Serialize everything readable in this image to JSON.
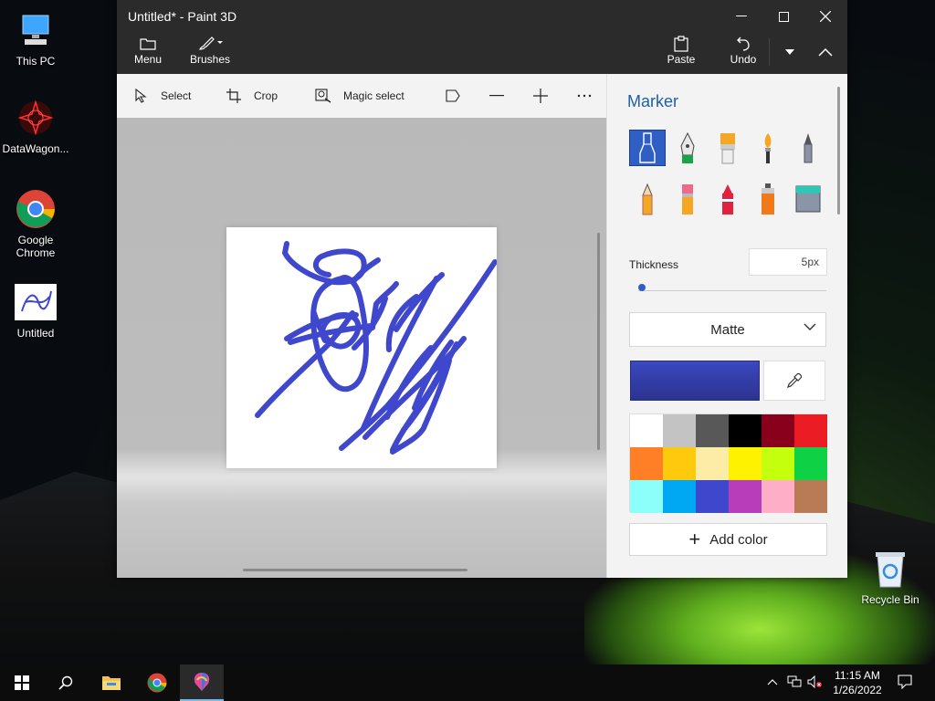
{
  "desktop": {
    "icons": [
      {
        "label": "This PC"
      },
      {
        "label": "DataWagon..."
      },
      {
        "label": "Google Chrome"
      },
      {
        "label": "Untitled"
      },
      {
        "label": "Recycle Bin"
      }
    ]
  },
  "window": {
    "title": "Untitled* - Paint 3D",
    "menu_label": "Menu",
    "brushes_label": "Brushes",
    "paste_label": "Paste",
    "undo_label": "Undo"
  },
  "toolbar": {
    "select_label": "Select",
    "crop_label": "Crop",
    "magic_select_label": "Magic select"
  },
  "panel": {
    "title": "Marker",
    "thickness_label": "Thickness",
    "thickness_value": "5px",
    "thickness_fraction": 0.02,
    "finish": "Matte",
    "current_color": "#3b48c0",
    "palette": [
      "#ffffff",
      "#c3c3c3",
      "#585858",
      "#000000",
      "#88001b",
      "#ec1c24",
      "#ff7f27",
      "#ffc90e",
      "#fdeca6",
      "#fff200",
      "#c4ff0e",
      "#0ed145",
      "#8cfffb",
      "#00a8f3",
      "#3f48cc",
      "#b83dba",
      "#ffaec8",
      "#b97a56"
    ],
    "add_color_label": "Add color"
  },
  "taskbar": {
    "time": "11:15 AM",
    "date": "1/26/2022"
  }
}
